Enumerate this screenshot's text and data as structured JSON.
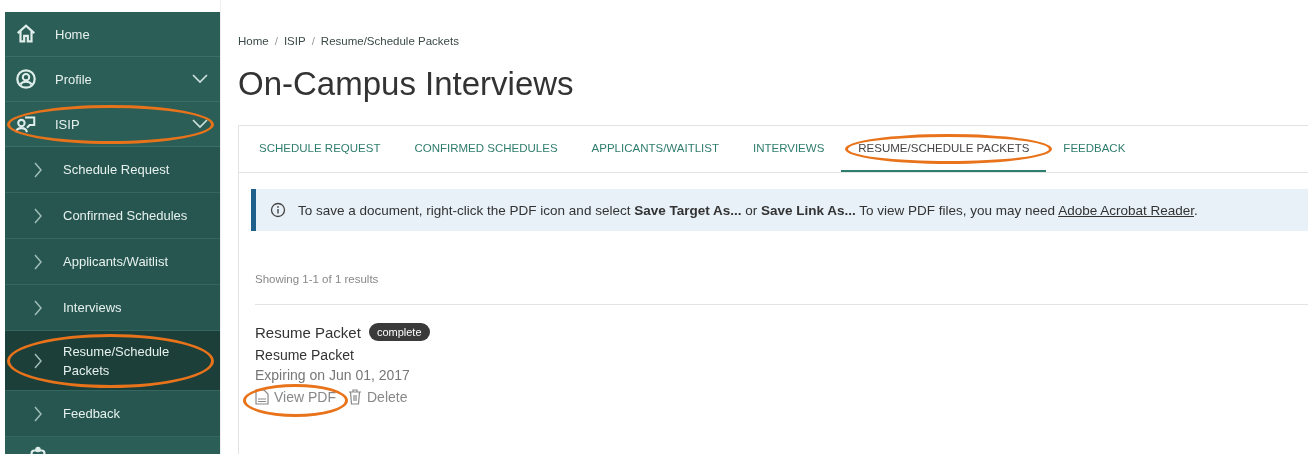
{
  "sidebar": {
    "items": [
      {
        "label": "Home",
        "kind": "link",
        "highlighted": false
      },
      {
        "label": "Profile",
        "kind": "group",
        "highlighted": false
      },
      {
        "label": "ISIP",
        "kind": "group",
        "highlighted": true,
        "children": [
          {
            "label": "Schedule Request",
            "selected": false,
            "highlighted": false
          },
          {
            "label": "Confirmed Schedules",
            "selected": false,
            "highlighted": false
          },
          {
            "label": "Applicants/Waitlist",
            "selected": false,
            "highlighted": false
          },
          {
            "label": "Interviews",
            "selected": false,
            "highlighted": false
          },
          {
            "label": "Resume/Schedule Packets",
            "selected": true,
            "highlighted": true
          },
          {
            "label": "Feedback",
            "selected": false,
            "highlighted": false
          }
        ]
      }
    ]
  },
  "breadcrumb": [
    {
      "label": "Home"
    },
    {
      "separator": "/",
      "label": "ISIP"
    },
    {
      "separator": "/",
      "label": "Resume/Schedule Packets"
    }
  ],
  "page_title": "On-Campus Interviews",
  "tabs": [
    {
      "label": "SCHEDULE REQUEST",
      "selected": false,
      "highlighted": false
    },
    {
      "label": "CONFIRMED SCHEDULES",
      "selected": false,
      "highlighted": false
    },
    {
      "label": "APPLICANTS/WAITLIST",
      "selected": false,
      "highlighted": false
    },
    {
      "label": "INTERVIEWS",
      "selected": false,
      "highlighted": false
    },
    {
      "label": "RESUME/SCHEDULE PACKETS",
      "selected": true,
      "highlighted": true
    },
    {
      "label": "FEEDBACK",
      "selected": false,
      "highlighted": false
    }
  ],
  "info": {
    "message": "To save a document, right-click the PDF icon and select **Save Target As...**  or **Save Link As...** To view PDF files, you may need",
    "link": "Adobe Acrobat Reader",
    "end": "."
  },
  "results_count": "Showing 1-1 of 1 results",
  "packets": [
    {
      "title": "Resume Packet",
      "status": "complete",
      "name": "Resume Packet",
      "expiry": "Expiring on Jun 01, 2017",
      "actions": [
        {
          "label": "View PDF",
          "kind": "pdf",
          "highlighted": true
        },
        {
          "label": "Delete",
          "kind": "delete",
          "highlighted": false
        }
      ]
    }
  ]
}
